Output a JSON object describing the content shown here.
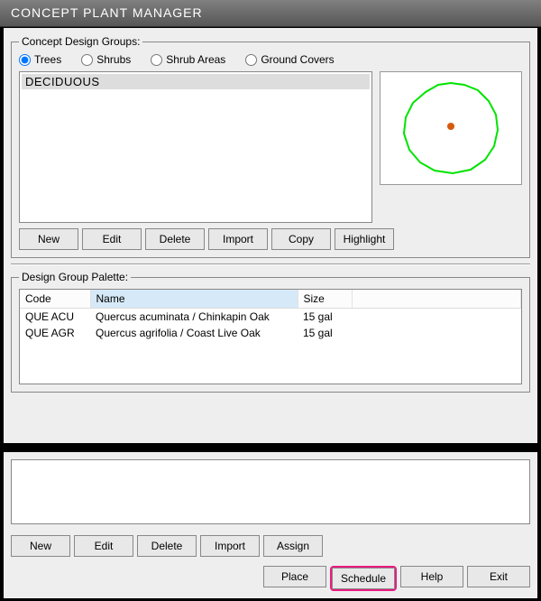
{
  "window": {
    "title": "CONCEPT PLANT MANAGER"
  },
  "groupbox": {
    "legend": "Concept Design Groups:",
    "radios": {
      "trees": {
        "label": "Trees",
        "checked": true
      },
      "shrubs": {
        "label": "Shrubs",
        "checked": false
      },
      "areas": {
        "label": "Shrub Areas",
        "checked": false
      },
      "ground": {
        "label": "Ground Covers",
        "checked": false
      }
    },
    "list": {
      "item0": "DECIDUOUS"
    },
    "buttons": {
      "new": "New",
      "edit": "Edit",
      "delete": "Delete",
      "import": "Import",
      "copy": "Copy",
      "highlight": "Highlight"
    }
  },
  "palette": {
    "legend": "Design Group Palette:",
    "headers": {
      "code": "Code",
      "name": "Name",
      "size": "Size"
    },
    "rows": [
      {
        "code": "QUE ACU",
        "name": "Quercus acuminata / Chinkapin Oak",
        "size": "15 gal"
      },
      {
        "code": "QUE AGR",
        "name": "Quercus agrifolia / Coast Live Oak",
        "size": "15 gal"
      }
    ]
  },
  "bottom": {
    "buttons": {
      "new": "New",
      "edit": "Edit",
      "delete": "Delete",
      "import": "Import",
      "assign": "Assign"
    }
  },
  "footer": {
    "place": "Place",
    "schedule": "Schedule",
    "help": "Help",
    "exit": "Exit"
  },
  "preview": {
    "stroke": "#00e300",
    "dot": "#d65a0e"
  }
}
